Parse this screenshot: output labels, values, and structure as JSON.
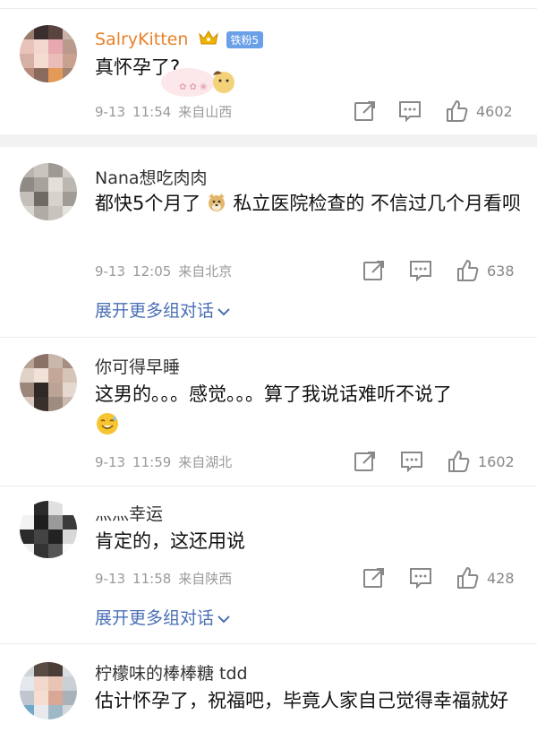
{
  "comments": [
    {
      "username": "SalryKitten",
      "fan_badge": "铁粉5",
      "text": "真怀孕了?",
      "date": "9-13",
      "time": "11:54",
      "location": "来自山西",
      "likes": "4602"
    },
    {
      "username": "Nana想吃肉肉",
      "text_before_emoji": "都快5个月了",
      "text_after_emoji": "私立医院检查的 不信过几个月看呗",
      "emoji": "doge-emoji",
      "date": "9-13",
      "time": "12:05",
      "location": "来自北京",
      "likes": "638",
      "expand_label": "展开更多组对话"
    },
    {
      "username": "你可得早睡",
      "text": "这男的。。。感觉。。。算了我说话难听不说了",
      "emoji": "smile-sweat-emoji",
      "date": "9-13",
      "time": "11:59",
      "location": "来自湖北",
      "likes": "1602"
    },
    {
      "username": "灬灬幸运",
      "text": "肯定的，这还用说",
      "date": "9-13",
      "time": "11:58",
      "location": "来自陕西",
      "likes": "428",
      "expand_label": "展开更多组对话"
    },
    {
      "username": "柠檬味的棒棒糖 tdd",
      "text": "估计怀孕了，祝福吧，毕竟人家自己觉得幸福就好"
    }
  ],
  "icons": {
    "share": "share-icon",
    "reply": "comment-icon",
    "like": "thumbs-up-icon"
  },
  "colors": {
    "username_vip": "#e8822a",
    "link": "#4a6fb5",
    "meta": "#9a9a9a"
  }
}
